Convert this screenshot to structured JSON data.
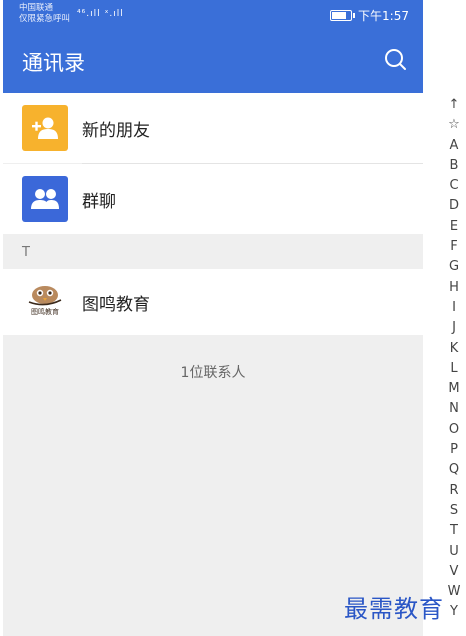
{
  "status_bar": {
    "carrier_line1": "中国联通",
    "carrier_line2": "仅限紧急呼叫",
    "signal_text": "⁴⁶.ıll ˣ.ıll",
    "time": "下午1:57"
  },
  "header": {
    "title": "通讯录"
  },
  "entries": [
    {
      "label": "新的朋友",
      "color": "#f7b22d",
      "icon": "add-friend-icon"
    },
    {
      "label": "群聊",
      "color": "#3b68d9",
      "icon": "group-chat-icon"
    }
  ],
  "section_letter": "T",
  "contacts": [
    {
      "name": "图鸣教育",
      "avatar_text": "图鸣教育"
    }
  ],
  "contact_count": "1位联系人",
  "index_letters": [
    "↑",
    "☆",
    "A",
    "B",
    "C",
    "D",
    "E",
    "F",
    "G",
    "H",
    "I",
    "J",
    "K",
    "L",
    "M",
    "N",
    "O",
    "P",
    "Q",
    "R",
    "S",
    "T",
    "U",
    "V",
    "W",
    "Y"
  ],
  "watermark": "最需教育",
  "colors": {
    "primary": "#3a6fd8",
    "background": "#efefef"
  }
}
